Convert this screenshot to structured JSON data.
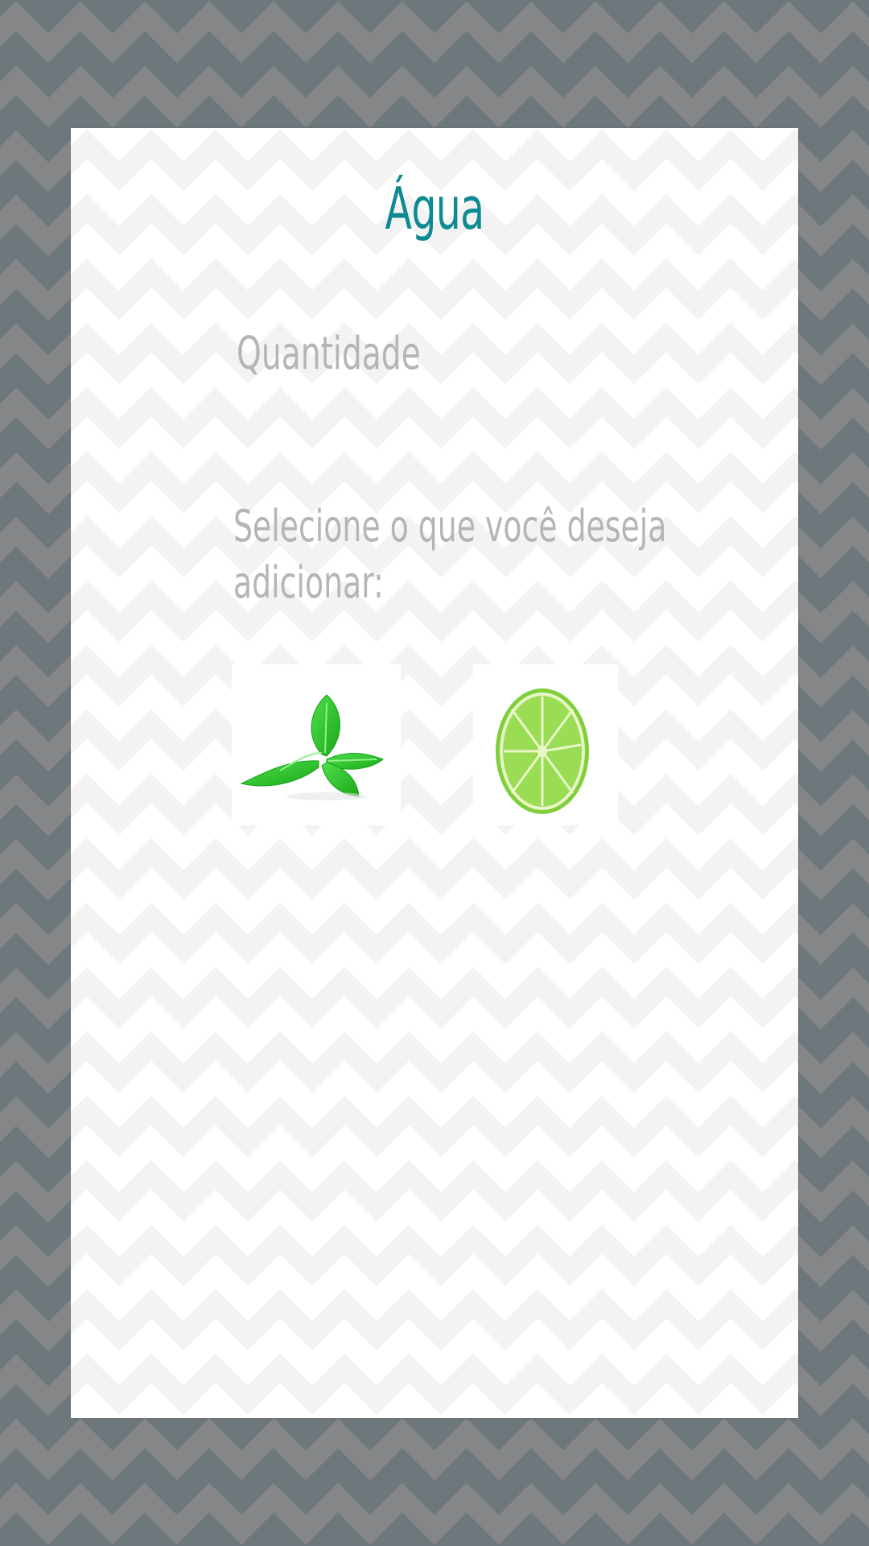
{
  "page": {
    "title": "Água",
    "quantity_label": "Quantidade",
    "select_label_line1": "Selecione o que você deseja",
    "select_label_line2": "adicionar:"
  },
  "options": [
    {
      "name": "mint",
      "icon": "mint-leaf-icon"
    },
    {
      "name": "lime",
      "icon": "lime-slice-icon"
    }
  ],
  "colors": {
    "title": "#0e8a93",
    "label": "#b5b5b5",
    "background": "#6e787c",
    "card": "#ffffff"
  }
}
